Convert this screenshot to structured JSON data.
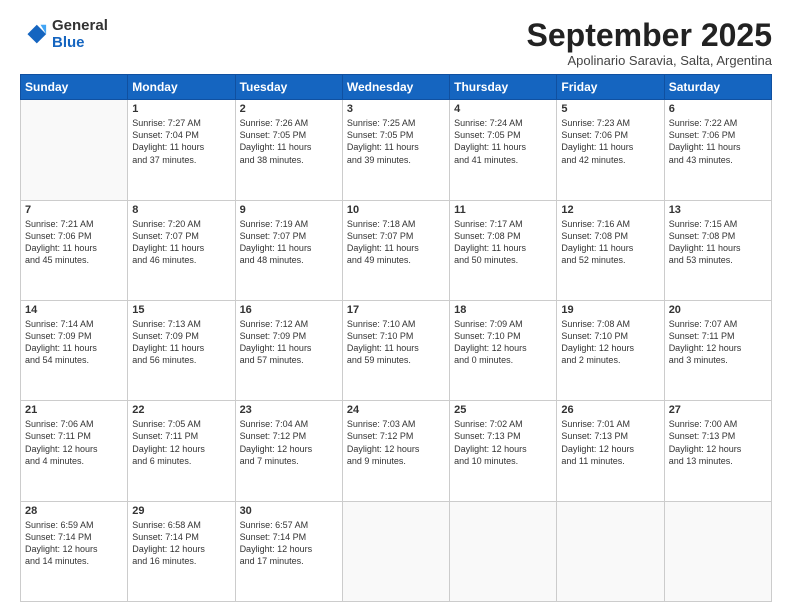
{
  "logo": {
    "general": "General",
    "blue": "Blue"
  },
  "title": "September 2025",
  "subtitle": "Apolinario Saravia, Salta, Argentina",
  "headers": [
    "Sunday",
    "Monday",
    "Tuesday",
    "Wednesday",
    "Thursday",
    "Friday",
    "Saturday"
  ],
  "weeks": [
    [
      {
        "day": "",
        "content": ""
      },
      {
        "day": "1",
        "content": "Sunrise: 7:27 AM\nSunset: 7:04 PM\nDaylight: 11 hours\nand 37 minutes."
      },
      {
        "day": "2",
        "content": "Sunrise: 7:26 AM\nSunset: 7:05 PM\nDaylight: 11 hours\nand 38 minutes."
      },
      {
        "day": "3",
        "content": "Sunrise: 7:25 AM\nSunset: 7:05 PM\nDaylight: 11 hours\nand 39 minutes."
      },
      {
        "day": "4",
        "content": "Sunrise: 7:24 AM\nSunset: 7:05 PM\nDaylight: 11 hours\nand 41 minutes."
      },
      {
        "day": "5",
        "content": "Sunrise: 7:23 AM\nSunset: 7:06 PM\nDaylight: 11 hours\nand 42 minutes."
      },
      {
        "day": "6",
        "content": "Sunrise: 7:22 AM\nSunset: 7:06 PM\nDaylight: 11 hours\nand 43 minutes."
      }
    ],
    [
      {
        "day": "7",
        "content": "Sunrise: 7:21 AM\nSunset: 7:06 PM\nDaylight: 11 hours\nand 45 minutes."
      },
      {
        "day": "8",
        "content": "Sunrise: 7:20 AM\nSunset: 7:07 PM\nDaylight: 11 hours\nand 46 minutes."
      },
      {
        "day": "9",
        "content": "Sunrise: 7:19 AM\nSunset: 7:07 PM\nDaylight: 11 hours\nand 48 minutes."
      },
      {
        "day": "10",
        "content": "Sunrise: 7:18 AM\nSunset: 7:07 PM\nDaylight: 11 hours\nand 49 minutes."
      },
      {
        "day": "11",
        "content": "Sunrise: 7:17 AM\nSunset: 7:08 PM\nDaylight: 11 hours\nand 50 minutes."
      },
      {
        "day": "12",
        "content": "Sunrise: 7:16 AM\nSunset: 7:08 PM\nDaylight: 11 hours\nand 52 minutes."
      },
      {
        "day": "13",
        "content": "Sunrise: 7:15 AM\nSunset: 7:08 PM\nDaylight: 11 hours\nand 53 minutes."
      }
    ],
    [
      {
        "day": "14",
        "content": "Sunrise: 7:14 AM\nSunset: 7:09 PM\nDaylight: 11 hours\nand 54 minutes."
      },
      {
        "day": "15",
        "content": "Sunrise: 7:13 AM\nSunset: 7:09 PM\nDaylight: 11 hours\nand 56 minutes."
      },
      {
        "day": "16",
        "content": "Sunrise: 7:12 AM\nSunset: 7:09 PM\nDaylight: 11 hours\nand 57 minutes."
      },
      {
        "day": "17",
        "content": "Sunrise: 7:10 AM\nSunset: 7:10 PM\nDaylight: 11 hours\nand 59 minutes."
      },
      {
        "day": "18",
        "content": "Sunrise: 7:09 AM\nSunset: 7:10 PM\nDaylight: 12 hours\nand 0 minutes."
      },
      {
        "day": "19",
        "content": "Sunrise: 7:08 AM\nSunset: 7:10 PM\nDaylight: 12 hours\nand 2 minutes."
      },
      {
        "day": "20",
        "content": "Sunrise: 7:07 AM\nSunset: 7:11 PM\nDaylight: 12 hours\nand 3 minutes."
      }
    ],
    [
      {
        "day": "21",
        "content": "Sunrise: 7:06 AM\nSunset: 7:11 PM\nDaylight: 12 hours\nand 4 minutes."
      },
      {
        "day": "22",
        "content": "Sunrise: 7:05 AM\nSunset: 7:11 PM\nDaylight: 12 hours\nand 6 minutes."
      },
      {
        "day": "23",
        "content": "Sunrise: 7:04 AM\nSunset: 7:12 PM\nDaylight: 12 hours\nand 7 minutes."
      },
      {
        "day": "24",
        "content": "Sunrise: 7:03 AM\nSunset: 7:12 PM\nDaylight: 12 hours\nand 9 minutes."
      },
      {
        "day": "25",
        "content": "Sunrise: 7:02 AM\nSunset: 7:13 PM\nDaylight: 12 hours\nand 10 minutes."
      },
      {
        "day": "26",
        "content": "Sunrise: 7:01 AM\nSunset: 7:13 PM\nDaylight: 12 hours\nand 11 minutes."
      },
      {
        "day": "27",
        "content": "Sunrise: 7:00 AM\nSunset: 7:13 PM\nDaylight: 12 hours\nand 13 minutes."
      }
    ],
    [
      {
        "day": "28",
        "content": "Sunrise: 6:59 AM\nSunset: 7:14 PM\nDaylight: 12 hours\nand 14 minutes."
      },
      {
        "day": "29",
        "content": "Sunrise: 6:58 AM\nSunset: 7:14 PM\nDaylight: 12 hours\nand 16 minutes."
      },
      {
        "day": "30",
        "content": "Sunrise: 6:57 AM\nSunset: 7:14 PM\nDaylight: 12 hours\nand 17 minutes."
      },
      {
        "day": "",
        "content": ""
      },
      {
        "day": "",
        "content": ""
      },
      {
        "day": "",
        "content": ""
      },
      {
        "day": "",
        "content": ""
      }
    ]
  ]
}
